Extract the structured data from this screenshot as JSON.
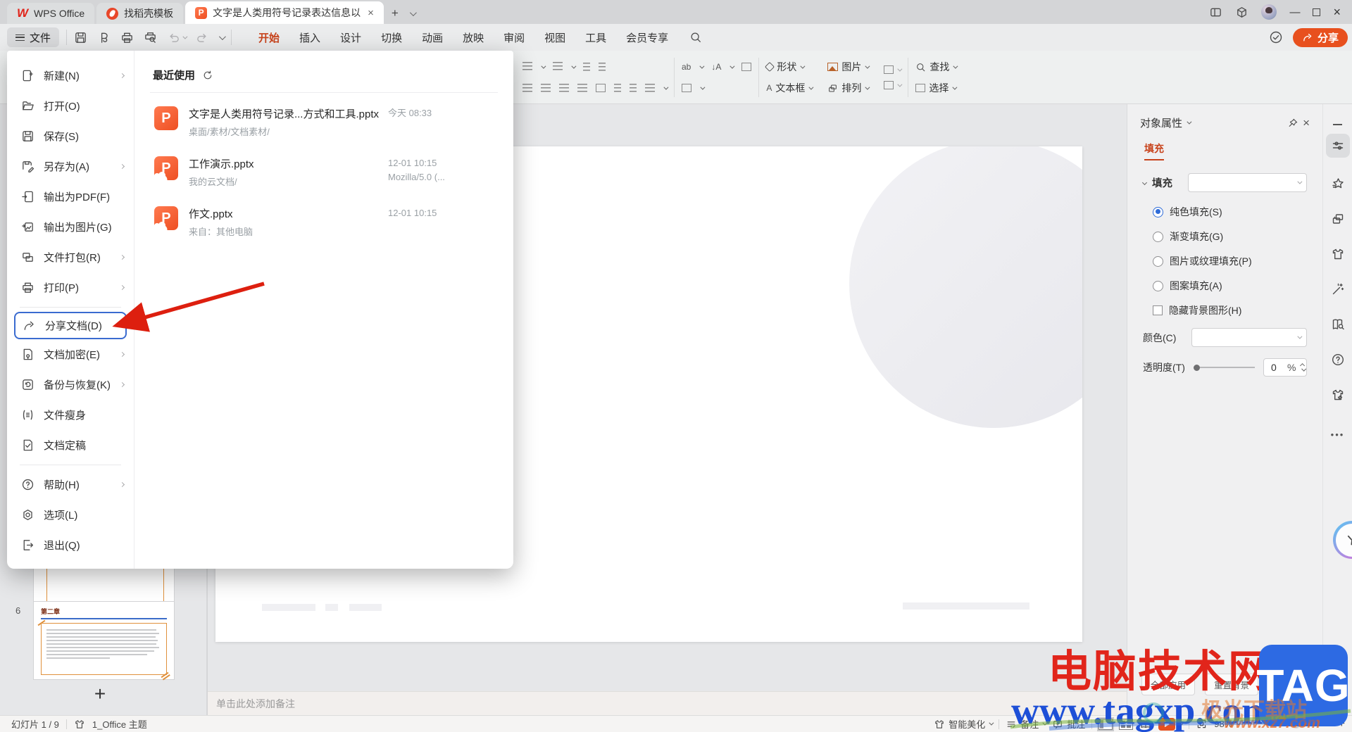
{
  "colors": {
    "accent_orange": "#e8501e",
    "accent_blue": "#2e6bd8",
    "arrow_red": "#dd1f0f"
  },
  "titlebar": {
    "tabs": [
      {
        "label": "WPS Office"
      },
      {
        "label": "找稻壳模板"
      },
      {
        "label": "文字是人类用符号记录表达信息以"
      }
    ],
    "close_tab": "×",
    "minimize": "—",
    "close_window": "×"
  },
  "toolbar": {
    "file_button": "文件",
    "menus": [
      "开始",
      "插入",
      "设计",
      "切换",
      "动画",
      "放映",
      "审阅",
      "视图",
      "工具",
      "会员专享"
    ],
    "share_button": "分享"
  },
  "ribbon": {
    "shape": "形状",
    "picture": "图片",
    "textbox": "文本框",
    "arrange": "排列",
    "find": "查找",
    "select": "选择"
  },
  "file_menu": {
    "items": [
      {
        "label": "新建(N)"
      },
      {
        "label": "打开(O)"
      },
      {
        "label": "保存(S)"
      },
      {
        "label": "另存为(A)"
      },
      {
        "label": "输出为PDF(F)"
      },
      {
        "label": "输出为图片(G)"
      },
      {
        "label": "文件打包(R)"
      },
      {
        "label": "打印(P)"
      },
      {
        "label": "分享文档(D)"
      },
      {
        "label": "文档加密(E)"
      },
      {
        "label": "备份与恢复(K)"
      },
      {
        "label": "文件瘦身"
      },
      {
        "label": "文档定稿"
      },
      {
        "label": "帮助(H)"
      },
      {
        "label": "选项(L)"
      },
      {
        "label": "退出(Q)"
      }
    ]
  },
  "recent": {
    "title": "最近使用",
    "files": [
      {
        "name": "文字是人类用符号记录...方式和工具.pptx",
        "path": "桌面/素材/文档素材/",
        "time": "今天  08:33",
        "meta": ""
      },
      {
        "name": "工作演示.pptx",
        "path": "我的云文档/",
        "time": "12-01 10:15",
        "meta": "Mozilla/5.0 (..."
      },
      {
        "name": "作文.pptx",
        "path": "来自：其他电脑",
        "time": "12-01 10:15",
        "meta": ""
      }
    ]
  },
  "properties": {
    "title": "对象属性",
    "tab": "填充",
    "section": "填充",
    "options": [
      "纯色填充(S)",
      "渐变填充(G)",
      "图片或纹理填充(P)",
      "图案填充(A)"
    ],
    "checkbox": "隐藏背景图形(H)",
    "color_label": "颜色(C)",
    "transparency_label": "透明度(T)",
    "transparency_value": "0",
    "transparency_unit": "%",
    "apply_all": "全部应用",
    "reset_bg": "重置背景"
  },
  "thumbnails": {
    "slide6_number": "6",
    "slide6_title": "第二章",
    "add_slide": "+"
  },
  "notes_placeholder": "单击此处添加备注",
  "statusbar": {
    "slide_info": "幻灯片 1 / 9",
    "theme": "1_Office 主题",
    "beautify": "智能美化",
    "notes": "备注",
    "comments": "批注",
    "zoom": "98%"
  },
  "watermark": {
    "title": "电脑技术网",
    "url": "www.tagxp.com",
    "badge": "TAG",
    "corner_site": "极光下载站",
    "corner_url": "www.xz7.com"
  }
}
